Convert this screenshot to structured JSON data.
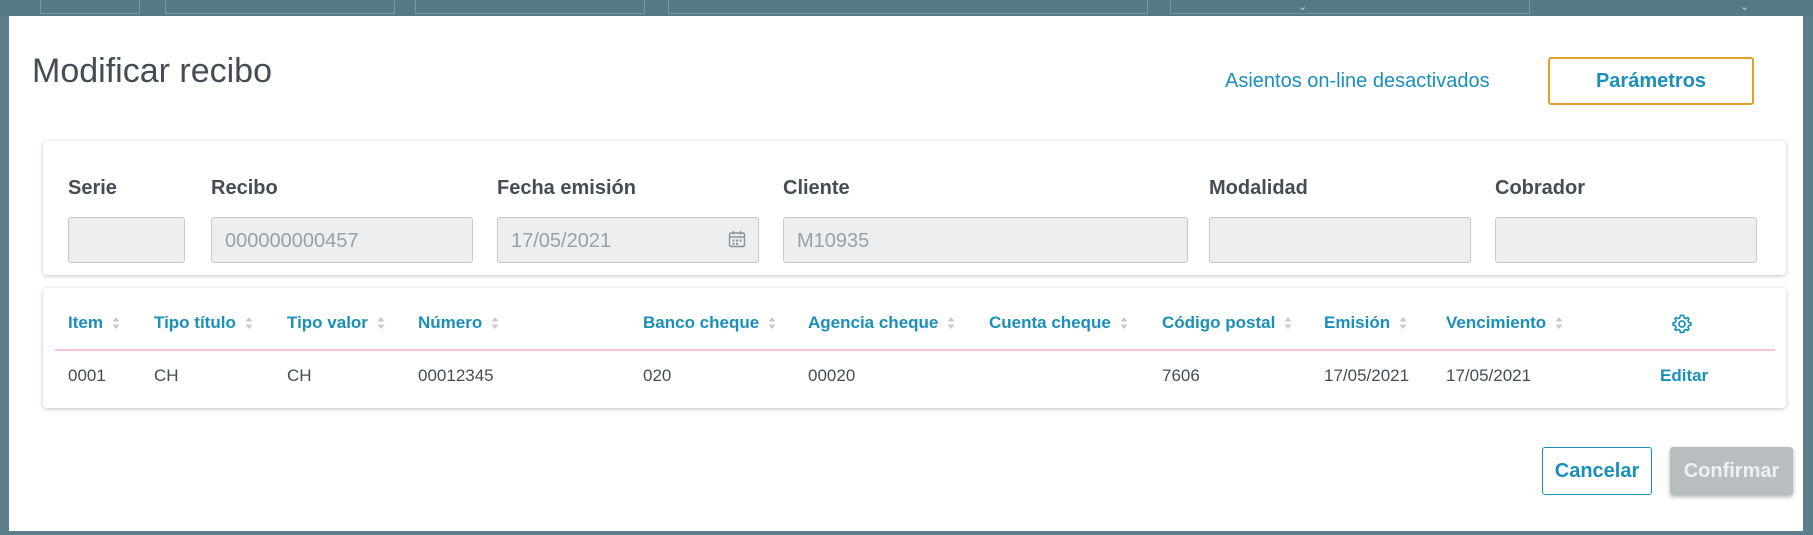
{
  "modal": {
    "title": "Modificar recibo",
    "online_status_link": "Asientos on-line desactivados",
    "parameters_button": "Parámetros"
  },
  "form": {
    "fields": [
      {
        "label": "Serie",
        "value": ""
      },
      {
        "label": "Recibo",
        "value": "000000000457"
      },
      {
        "label": "Fecha emisión",
        "value": "17/05/2021",
        "icon": "calendar-icon"
      },
      {
        "label": "Cliente",
        "value": "M10935"
      },
      {
        "label": "Modalidad",
        "value": ""
      },
      {
        "label": "Cobrador",
        "value": ""
      }
    ]
  },
  "table": {
    "columns": [
      "Item",
      "Tipo título",
      "Tipo valor",
      "Número",
      "Banco cheque",
      "Agencia cheque",
      "Cuenta cheque",
      "Código postal",
      "Emisión",
      "Vencimiento"
    ],
    "settings_icon": "gear-icon",
    "rows": [
      {
        "cells": [
          "0001",
          "CH",
          "CH",
          "00012345",
          "020",
          "00020",
          "",
          "7606",
          "17/05/2021",
          "17/05/2021"
        ],
        "action": "Editar"
      }
    ]
  },
  "footer": {
    "cancel_label": "Cancelar",
    "confirm_label": "Confirmar"
  },
  "colors": {
    "accent": "#1a8fb9",
    "highlight_border": "#e0a030",
    "disabled_button": "#b8bdc0"
  }
}
